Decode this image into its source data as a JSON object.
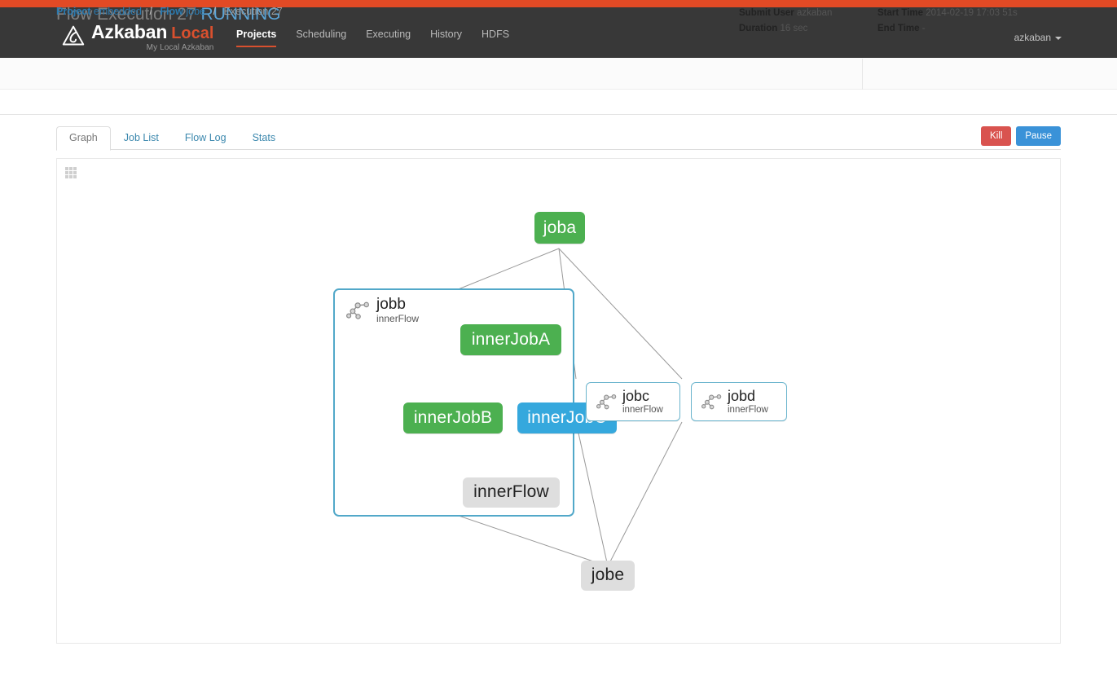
{
  "brand": {
    "name": "Azkaban",
    "local": "Local",
    "tagline": "My Local Azkaban",
    "logo_icon": "azkaban-triangle-logo"
  },
  "nav": {
    "links": [
      {
        "label": "Projects",
        "active": true
      },
      {
        "label": "Scheduling",
        "active": false
      },
      {
        "label": "Executing",
        "active": false
      },
      {
        "label": "History",
        "active": false
      },
      {
        "label": "HDFS",
        "active": false
      }
    ],
    "user": "azkaban",
    "user_caret_icon": "chevron-down-icon"
  },
  "execution": {
    "title_prefix": "Flow Execution",
    "id": "27",
    "status": "RUNNING",
    "submit_user_label": "Submit User",
    "submit_user": "azkaban",
    "duration_label": "Duration",
    "duration": "16 sec",
    "start_time_label": "Start Time",
    "start_time": "2014-02-19 17:03 51s",
    "end_time_label": "End Time",
    "end_time": "-"
  },
  "breadcrumb": {
    "project_label": "Project",
    "project_name": "embedded",
    "flow_label": "Flow",
    "flow_name": "jobe",
    "current": "Execution 27",
    "separator": "/"
  },
  "tabs": [
    {
      "label": "Graph",
      "active": true
    },
    {
      "label": "Job List",
      "active": false
    },
    {
      "label": "Flow Log",
      "active": false
    },
    {
      "label": "Stats",
      "active": false
    }
  ],
  "actions": {
    "kill_label": "Kill",
    "pause_label": "Pause",
    "kill_color": "#d9534f",
    "pause_color": "#3a92d8"
  },
  "graph": {
    "drag_handle_icon": "grid-dots-handle-icon",
    "status_colors": {
      "succeeded": "#4cb050",
      "running": "#35a8dd",
      "ready": "#dedede",
      "flow_border": "#52a8c9"
    },
    "nodes": [
      {
        "id": "joba",
        "label": "joba",
        "state": "succeeded"
      },
      {
        "id": "jobb",
        "label": "jobb",
        "sublabel": "innerFlow",
        "state": "expanded-flow"
      },
      {
        "id": "innerJobA",
        "label": "innerJobA",
        "state": "succeeded"
      },
      {
        "id": "innerJobB",
        "label": "innerJobB",
        "state": "succeeded"
      },
      {
        "id": "innerJobC",
        "label": "innerJobC",
        "state": "running"
      },
      {
        "id": "innerFlow",
        "label": "innerFlow",
        "state": "ready"
      },
      {
        "id": "jobc",
        "label": "jobc",
        "sublabel": "innerFlow",
        "state": "collapsed-flow"
      },
      {
        "id": "jobd",
        "label": "jobd",
        "sublabel": "innerFlow",
        "state": "collapsed-flow"
      },
      {
        "id": "jobe",
        "label": "jobe",
        "state": "ready"
      }
    ],
    "edges": [
      {
        "from": "joba",
        "to": "jobb"
      },
      {
        "from": "joba",
        "to": "jobc"
      },
      {
        "from": "joba",
        "to": "jobd"
      },
      {
        "from": "innerJobA",
        "to": "innerJobB"
      },
      {
        "from": "innerJobA",
        "to": "innerJobC"
      },
      {
        "from": "innerJobB",
        "to": "innerFlow"
      },
      {
        "from": "innerJobC",
        "to": "innerFlow"
      },
      {
        "from": "jobb",
        "to": "jobe"
      },
      {
        "from": "jobc",
        "to": "jobe"
      },
      {
        "from": "jobd",
        "to": "jobe"
      }
    ]
  },
  "theme": {
    "accent": "#e24a25",
    "navbar_bg": "#383838",
    "link_blue": "#2a7ab0"
  }
}
